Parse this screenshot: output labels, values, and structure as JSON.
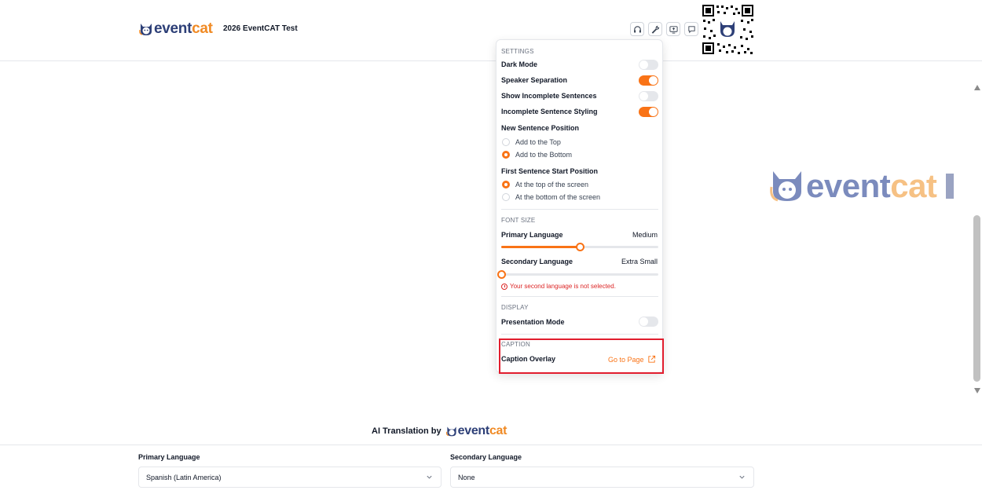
{
  "header": {
    "brand_left": "event",
    "brand_right": "cat",
    "event_title": "2026 EventCAT Test",
    "toolbar": [
      {
        "name": "headphones-icon"
      },
      {
        "name": "wrench-icon"
      },
      {
        "name": "screen-share-icon"
      },
      {
        "name": "chat-icon"
      }
    ],
    "qr_code": "qr-code"
  },
  "settings": {
    "section_settings": "SETTINGS",
    "dark_mode": "Dark Mode",
    "dark_mode_on": false,
    "speaker_separation": "Speaker Separation",
    "speaker_separation_on": true,
    "show_incomplete": "Show Incomplete Sentences",
    "show_incomplete_on": false,
    "incomplete_styling": "Incomplete Sentence Styling",
    "incomplete_styling_on": true,
    "new_sentence_position": "New Sentence Position",
    "new_sentence_options": [
      "Add to the Top",
      "Add to the Bottom"
    ],
    "new_sentence_selected": "Add to the Bottom",
    "first_sentence_position": "First Sentence Start Position",
    "first_sentence_options": [
      "At the top of the screen",
      "At the bottom of the screen"
    ],
    "first_sentence_selected": "At the top of the screen",
    "section_font_size": "FONT SIZE",
    "primary_language": "Primary Language",
    "primary_size": "Medium",
    "primary_level": 0.5,
    "secondary_language": "Secondary Language",
    "secondary_size": "Extra Small",
    "secondary_level": 0.0,
    "secondary_warning": "Your second language is not selected.",
    "section_display": "DISPLAY",
    "presentation_mode": "Presentation Mode",
    "presentation_mode_on": false,
    "section_caption": "CAPTION",
    "caption_overlay": "Caption Overlay",
    "go_to_page": "Go to Page"
  },
  "footer": {
    "ai_translation_by": "AI Translation by",
    "primary_language_label": "Primary Language",
    "primary_language_value": "Spanish (Latin America)",
    "secondary_language_label": "Secondary Language",
    "secondary_language_value": "None"
  },
  "colors": {
    "brand_navy": "#2d3f77",
    "brand_orange": "#f08a24",
    "accent": "#f97316",
    "highlight_box": "#e11d2e"
  }
}
